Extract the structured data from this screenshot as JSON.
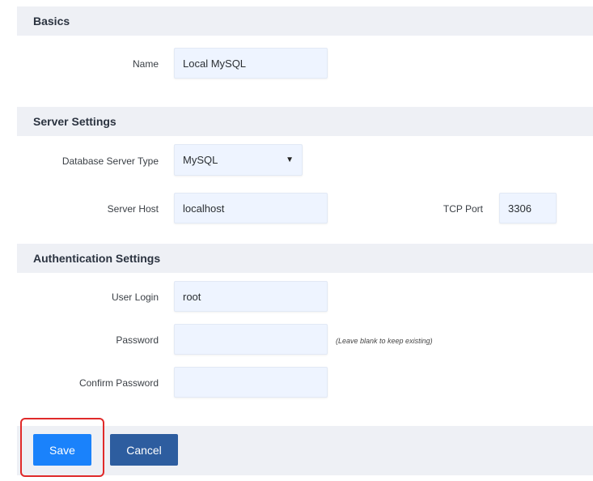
{
  "sections": {
    "basics": "Basics",
    "server": "Server Settings",
    "auth": "Authentication Settings"
  },
  "basics": {
    "name_label": "Name",
    "name_value": "Local MySQL"
  },
  "server": {
    "db_type_label": "Database Server Type",
    "db_type_value": "MySQL",
    "host_label": "Server Host",
    "host_value": "localhost",
    "port_label": "TCP Port",
    "port_value": "3306"
  },
  "auth": {
    "login_label": "User Login",
    "login_value": "root",
    "password_label": "Password",
    "password_hint": "(Leave blank to keep existing)",
    "confirm_label": "Confirm Password"
  },
  "actions": {
    "save_label": "Save",
    "cancel_label": "Cancel"
  },
  "colors": {
    "save": "#1a82fb",
    "cancel": "#2d5d9f",
    "highlight": "#e02a2a"
  }
}
